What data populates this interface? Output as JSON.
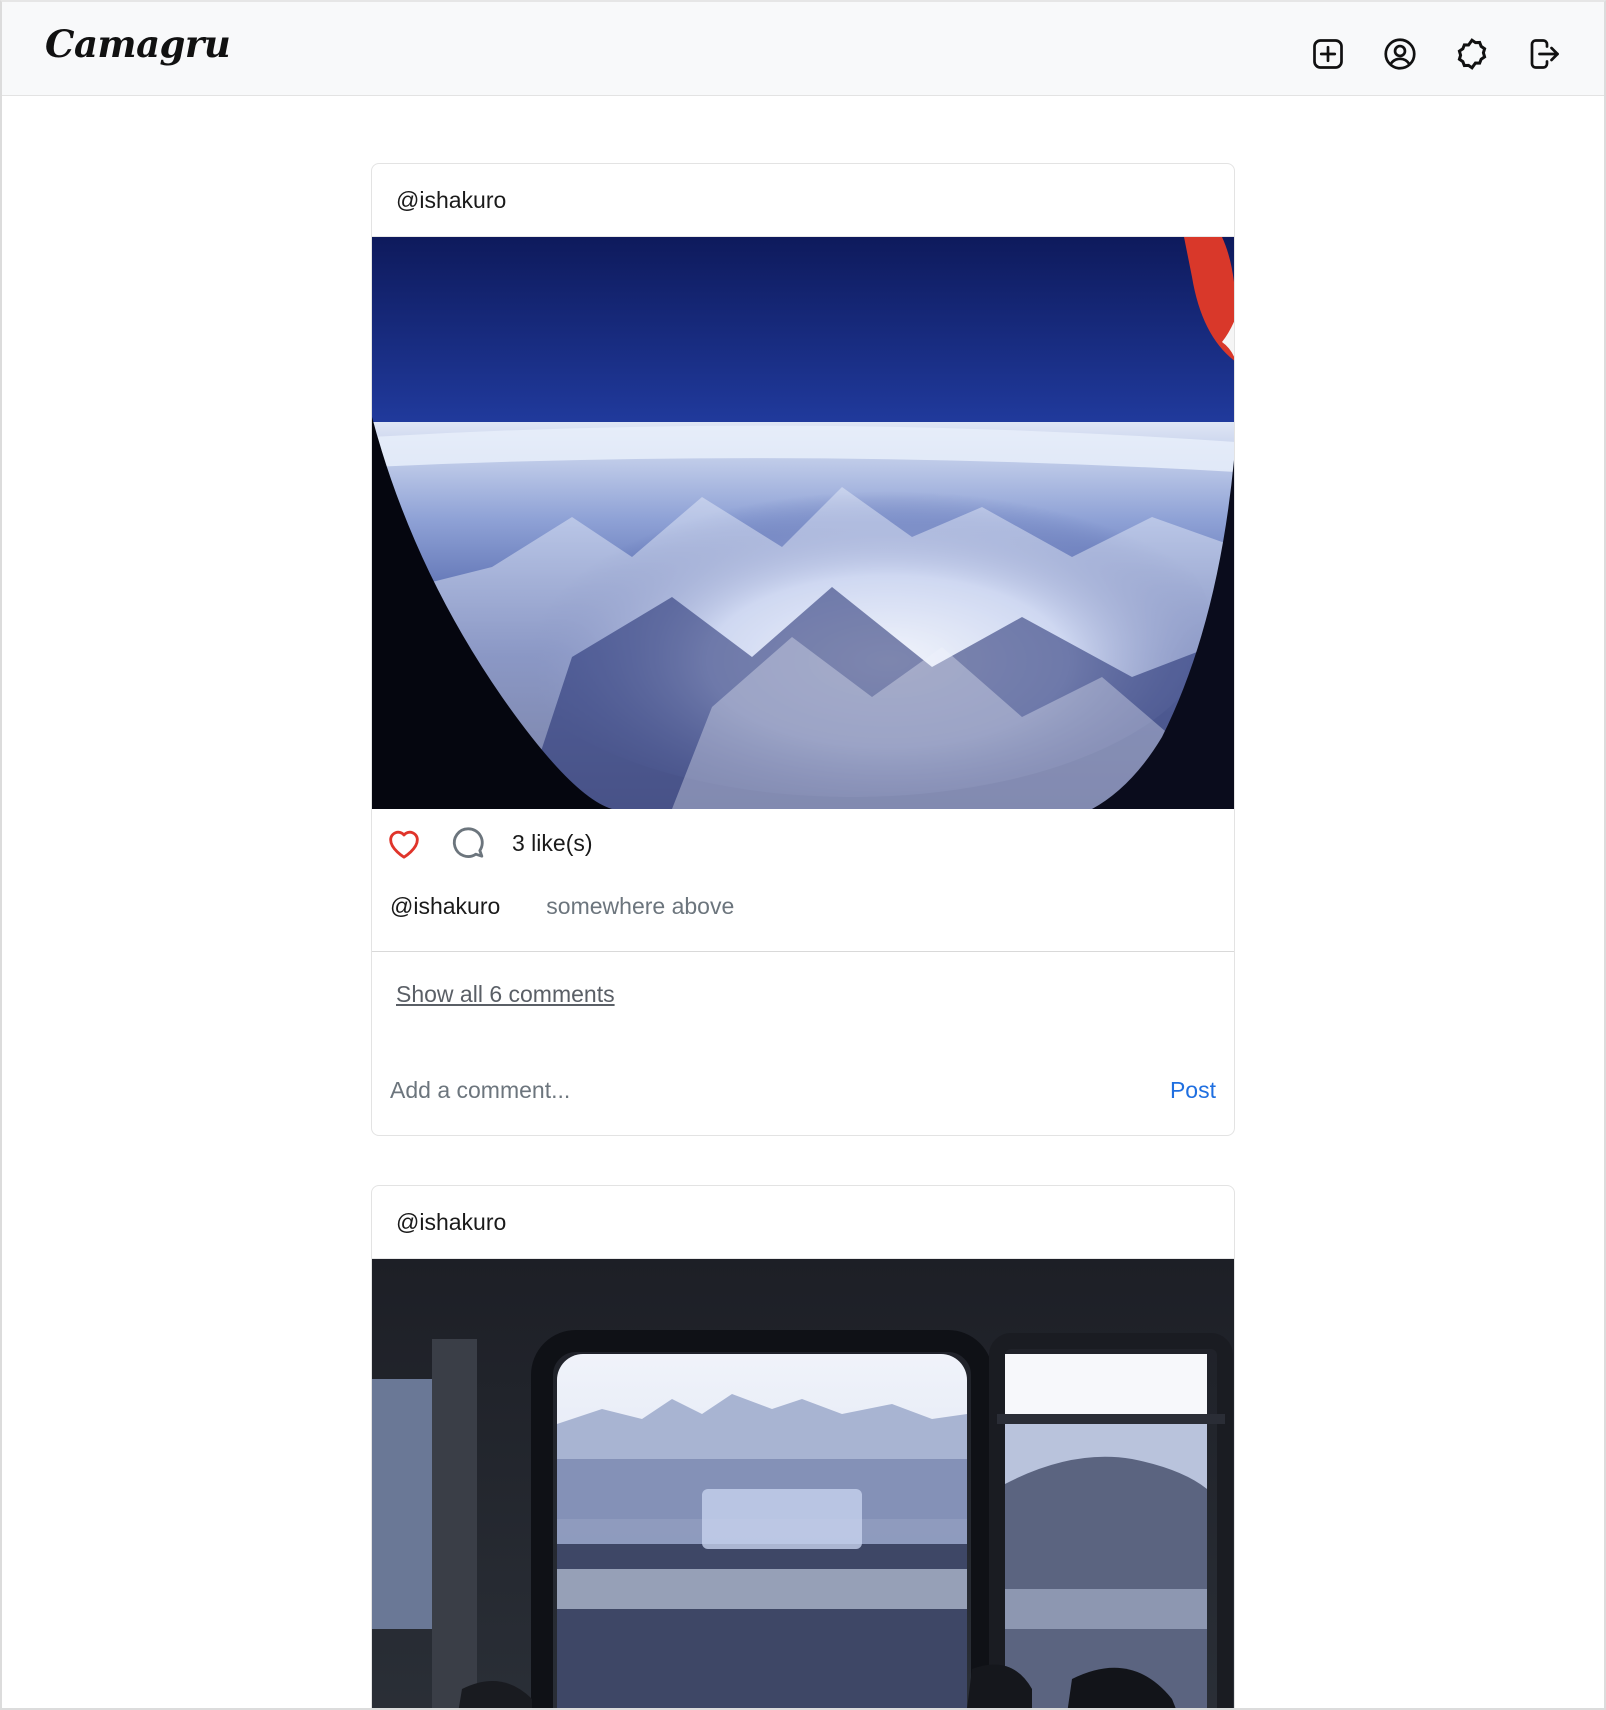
{
  "navbar": {
    "brand": "Camagru",
    "icons": [
      "plus-square-icon",
      "user-circle-icon",
      "settings-icon",
      "logout-icon"
    ]
  },
  "posts": [
    {
      "author": "@ishakuro",
      "photo_description": "aerial-mountains-from-plane-window",
      "likes_text": "3 like(s)",
      "caption_user": "@ishakuro",
      "caption_text": "somewhere above",
      "show_comments": "Show all 6 comments",
      "comment_placeholder": "Add a comment...",
      "post_label": "Post"
    },
    {
      "author": "@ishakuro",
      "photo_description": "train-window-town-view"
    }
  ],
  "colors": {
    "heart": "#e0342a",
    "link_blue": "#1f6fe0",
    "navbar_bg": "#f8f9fa"
  }
}
